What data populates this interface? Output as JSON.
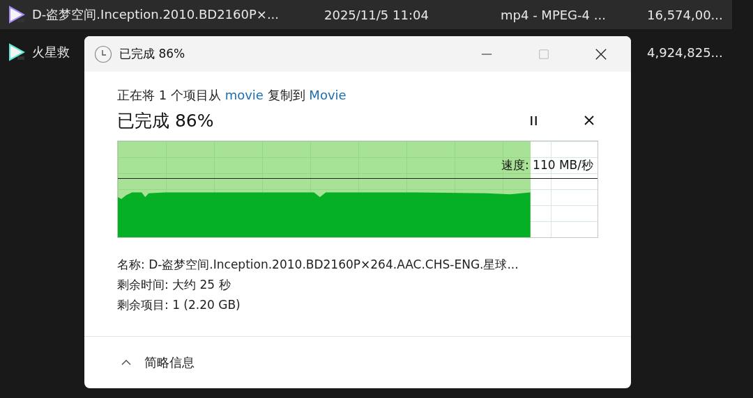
{
  "explorer": {
    "rows": [
      {
        "name": "D-盗梦空间.Inception.2010.BD2160P×...",
        "date": "2025/11/5 11:04",
        "type": "mp4 - MPEG-4 ...",
        "size": "16,574,00...",
        "selected": true
      },
      {
        "name": "火星救",
        "size": "4,924,825...",
        "selected": false
      }
    ]
  },
  "dialog": {
    "title": "已完成 86%",
    "copy_line": [
      {
        "kind": "text",
        "text": "正在将 1 个项目从 "
      },
      {
        "kind": "link",
        "text": "movie"
      },
      {
        "kind": "text",
        "text": " 复制到 "
      },
      {
        "kind": "link",
        "text": "Movie"
      }
    ],
    "progress_title": "已完成 86%",
    "progress": {
      "level": 0.86,
      "speed": "速度: 110 MB/秒"
    },
    "details": [
      "名称: D-盗梦空间.Inception.2010.BD2160P×264.AAC.CHS-ENG.星球...",
      "剩余时间: 大约 25 秒",
      "剩余项目: 1 (2.20 GB)"
    ],
    "footer": {
      "label": "简略信息",
      "expanded": true
    }
  }
}
